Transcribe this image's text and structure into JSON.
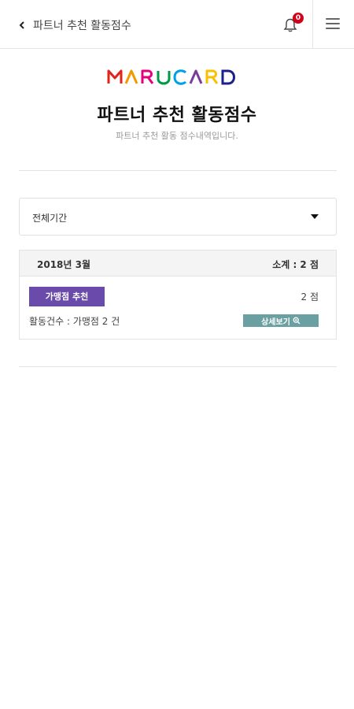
{
  "header": {
    "title": "파트너 추천 활동점수",
    "notification_count": "0"
  },
  "logo": {
    "text": "MARUCARD"
  },
  "page": {
    "title": "파트너 추천 활동점수",
    "subtitle": "파트너 추천 활동 점수내역입니다."
  },
  "filter": {
    "selected_period": "전체기간"
  },
  "records": [
    {
      "month": "2018년 3월",
      "subtotal": "소계 : 2 점",
      "items": [
        {
          "category": "가맹점 추천",
          "points": "2 점",
          "activity": "활동건수 : 가맹점 2 건",
          "detail_label": "상세보기"
        }
      ]
    }
  ],
  "colors": {
    "category_badge": "#6a4bab",
    "detail_button": "#6ba0a2",
    "notification_badge": "#d0021b",
    "logo": [
      "#e2231a",
      "#f39800",
      "#e4007f",
      "#009944",
      "#00a0e9",
      "#7d3c98",
      "#f9c000",
      "#1d2088"
    ]
  },
  "icons": {
    "back": "chevron-left-icon",
    "notifications": "bell-icon",
    "menu": "hamburger-menu-icon",
    "detail": "magnifier-plus-icon",
    "dropdown": "caret-down-icon"
  }
}
